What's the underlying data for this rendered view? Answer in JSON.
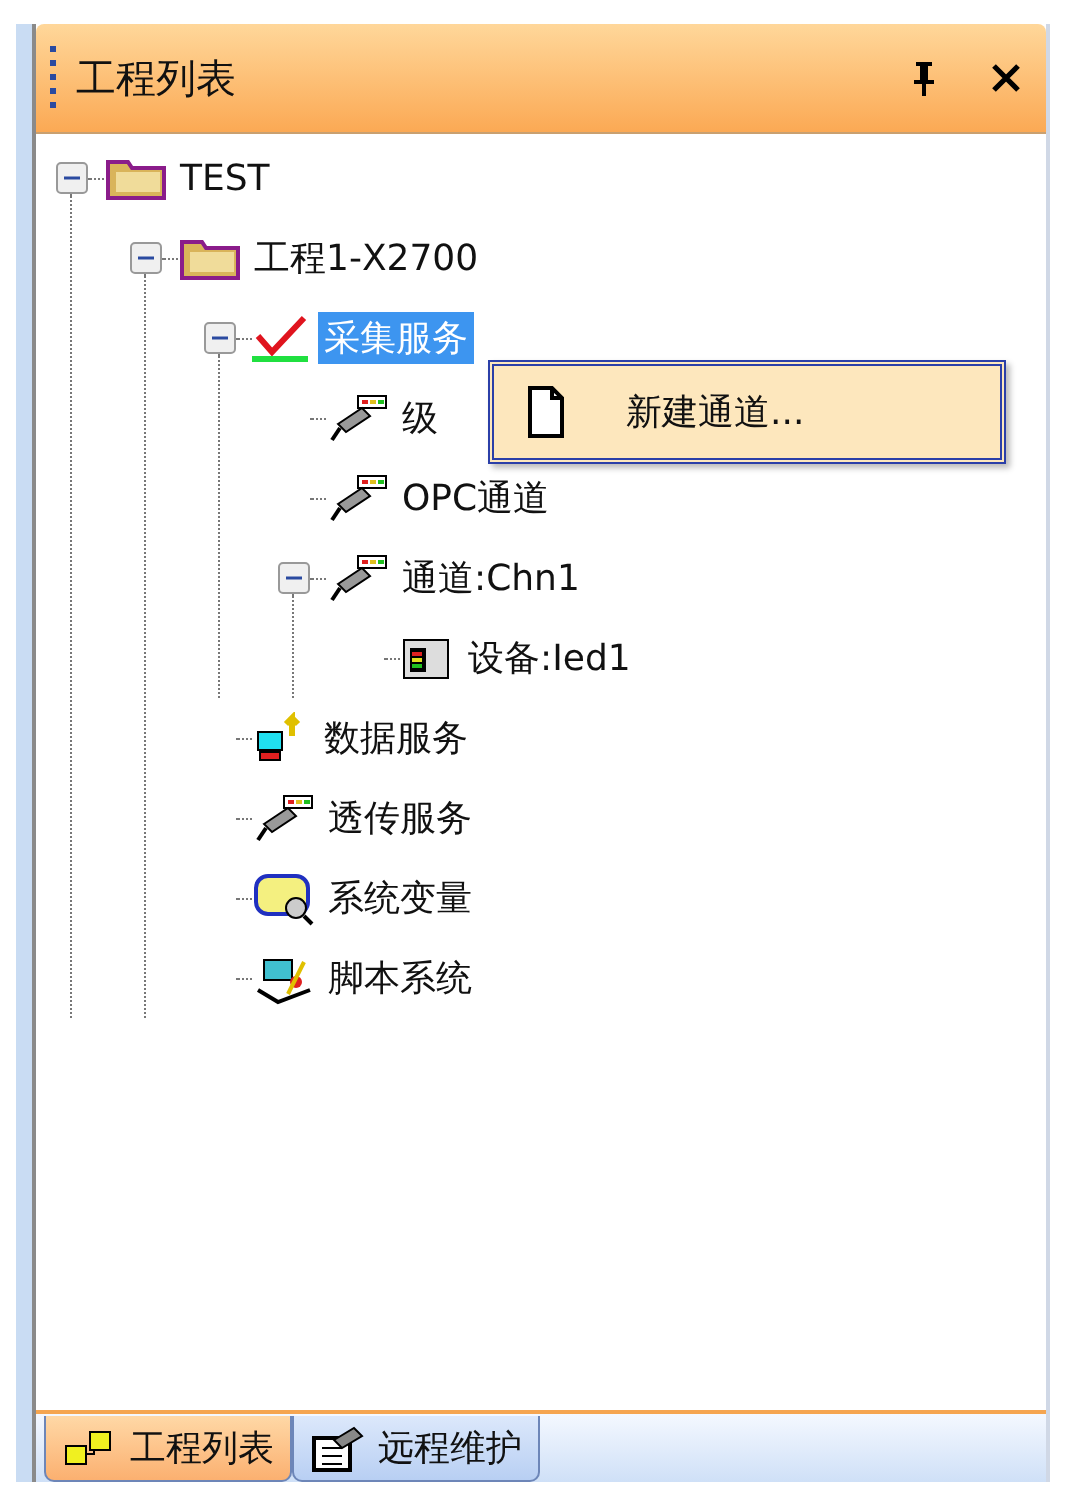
{
  "panel": {
    "title": "工程列表"
  },
  "tree": [
    {
      "label": "TEST",
      "kind": "folder",
      "selected": false,
      "expanded": true,
      "children": [
        {
          "label": "工程1-X2700",
          "kind": "folder",
          "selected": false,
          "expanded": true,
          "children": [
            {
              "label": "采集服务",
              "kind": "check",
              "selected": true,
              "expanded": true,
              "children": [
                {
                  "label": "级",
                  "kind": "channel",
                  "selected": false
                },
                {
                  "label": "OPC通道",
                  "kind": "channel",
                  "selected": false
                },
                {
                  "label": "通道:Chn1",
                  "kind": "channel",
                  "selected": false,
                  "expanded": true,
                  "children": [
                    {
                      "label": "设备:Ied1",
                      "kind": "device",
                      "selected": false
                    }
                  ]
                }
              ]
            },
            {
              "label": "数据服务",
              "kind": "data",
              "selected": false
            },
            {
              "label": "透传服务",
              "kind": "channel",
              "selected": false
            },
            {
              "label": "系统变量",
              "kind": "variable",
              "selected": false
            },
            {
              "label": "脚本系统",
              "kind": "script",
              "selected": false
            }
          ]
        }
      ]
    }
  ],
  "context_menu": {
    "items": [
      "新建通道..."
    ]
  },
  "tabs": [
    {
      "label": "工程列表",
      "kind": "project",
      "selected": true
    },
    {
      "label": "远程维护",
      "kind": "remote",
      "selected": false
    }
  ]
}
